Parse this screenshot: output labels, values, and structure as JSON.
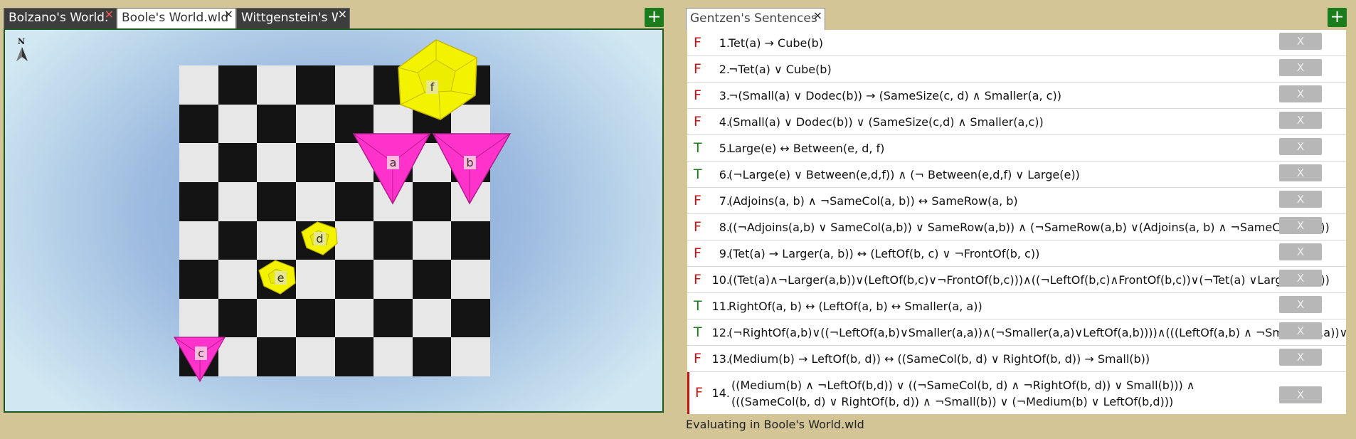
{
  "world_tabs": [
    {
      "label": "Bolzano's World.",
      "active": false
    },
    {
      "label": "Boole's World.wld",
      "active": true
    },
    {
      "label": "Wittgenstein's W",
      "active": false
    }
  ],
  "close_glyph": "×",
  "add_label": "+",
  "compass": {
    "north": "N"
  },
  "world_objects": [
    {
      "name": "f",
      "shape": "dodecahedron",
      "size": "large",
      "color": "#f0f000"
    },
    {
      "name": "a",
      "shape": "tetrahedron",
      "size": "large",
      "color": "#ff33cc"
    },
    {
      "name": "b",
      "shape": "tetrahedron",
      "size": "large",
      "color": "#ff33cc"
    },
    {
      "name": "d",
      "shape": "dodecahedron",
      "size": "small",
      "color": "#f0f000"
    },
    {
      "name": "e",
      "shape": "dodecahedron",
      "size": "small",
      "color": "#f0f000"
    },
    {
      "name": "c",
      "shape": "tetrahedron",
      "size": "small",
      "color": "#ff33cc"
    }
  ],
  "sentences_tab": {
    "label": "Gentzen's Sentences"
  },
  "sentences": [
    {
      "truth": "F",
      "num": "1.",
      "text": "Tet(a) → Cube(b)"
    },
    {
      "truth": "F",
      "num": "2.",
      "text": "¬Tet(a) ∨ Cube(b)"
    },
    {
      "truth": "F",
      "num": "3.",
      "text": " ¬(Small(a) ∨ Dodec(b)) → (SameSize(c, d) ∧ Smaller(a, c))"
    },
    {
      "truth": "F",
      "num": "4.",
      "text": "(Small(a) ∨ Dodec(b)) ∨ (SameSize(c,d) ∧ Smaller(a,c))"
    },
    {
      "truth": "T",
      "num": "5.",
      "text": "Large(e) ↔ Between(e, d, f)"
    },
    {
      "truth": "T",
      "num": "6.",
      "text": "(¬Large(e) ∨ Between(e,d,f)) ∧ (¬ Between(e,d,f) ∨ Large(e))"
    },
    {
      "truth": "F",
      "num": "7.",
      "text": "(Adjoins(a, b) ∧ ¬SameCol(a, b)) ↔ SameRow(a, b)"
    },
    {
      "truth": "F",
      "num": "8.",
      "text": "((¬Adjoins(a,b) ∨ SameCol(a,b)) ∨ SameRow(a,b)) ∧ (¬SameRow(a,b) ∨(Adjoins(a, b) ∧ ¬SameCol(a, b)))"
    },
    {
      "truth": "F",
      "num": "9.",
      "text": "(Tet(a) → Larger(a, b)) ↔ (LeftOf(b, c) ∨ ¬FrontOf(b, c))"
    },
    {
      "truth": "F",
      "num": "10.",
      "text": "((Tet(a)∧¬Larger(a,b))∨(LeftOf(b,c)∨¬FrontOf(b,c)))∧((¬LeftOf(b,c)∧FrontOf(b,c))∨(¬Tet(a) ∨Larger(a,b)))"
    },
    {
      "truth": "T",
      "num": "11.",
      "text": "RightOf(a, b) ↔ (LeftOf(a, b) ↔ Smaller(a, a))"
    },
    {
      "truth": "T",
      "num": "12.",
      "text": "(¬RightOf(a,b)∨((¬LeftOf(a,b)∨Smaller(a,a))∧(¬Smaller(a,a)∨LeftOf(a,b))))∧(((LeftOf(a,b) ∧ ¬Smaller(a,a))∨"
    },
    {
      "truth": "F",
      "num": "13.",
      "text": "(Medium(b) → LeftOf(b, d)) ↔ ((SameCol(b, d) ∨ RightOf(b, d)) → Small(b))"
    },
    {
      "truth": "F",
      "num": "14.",
      "text": "((Medium(b) ∧ ¬LeftOf(b,d)) ∨ ((¬SameCol(b, d) ∧ ¬RightOf(b, d)) ∨ Small(b))) ∧\n(((SameCol(b, d) ∨ RightOf(b, d)) ∧ ¬Small(b)) ∨ (¬Medium(b) ∨ LeftOf(b,d)))"
    }
  ],
  "remove_label": "X",
  "status": "Evaluating in Boole's World.wld"
}
